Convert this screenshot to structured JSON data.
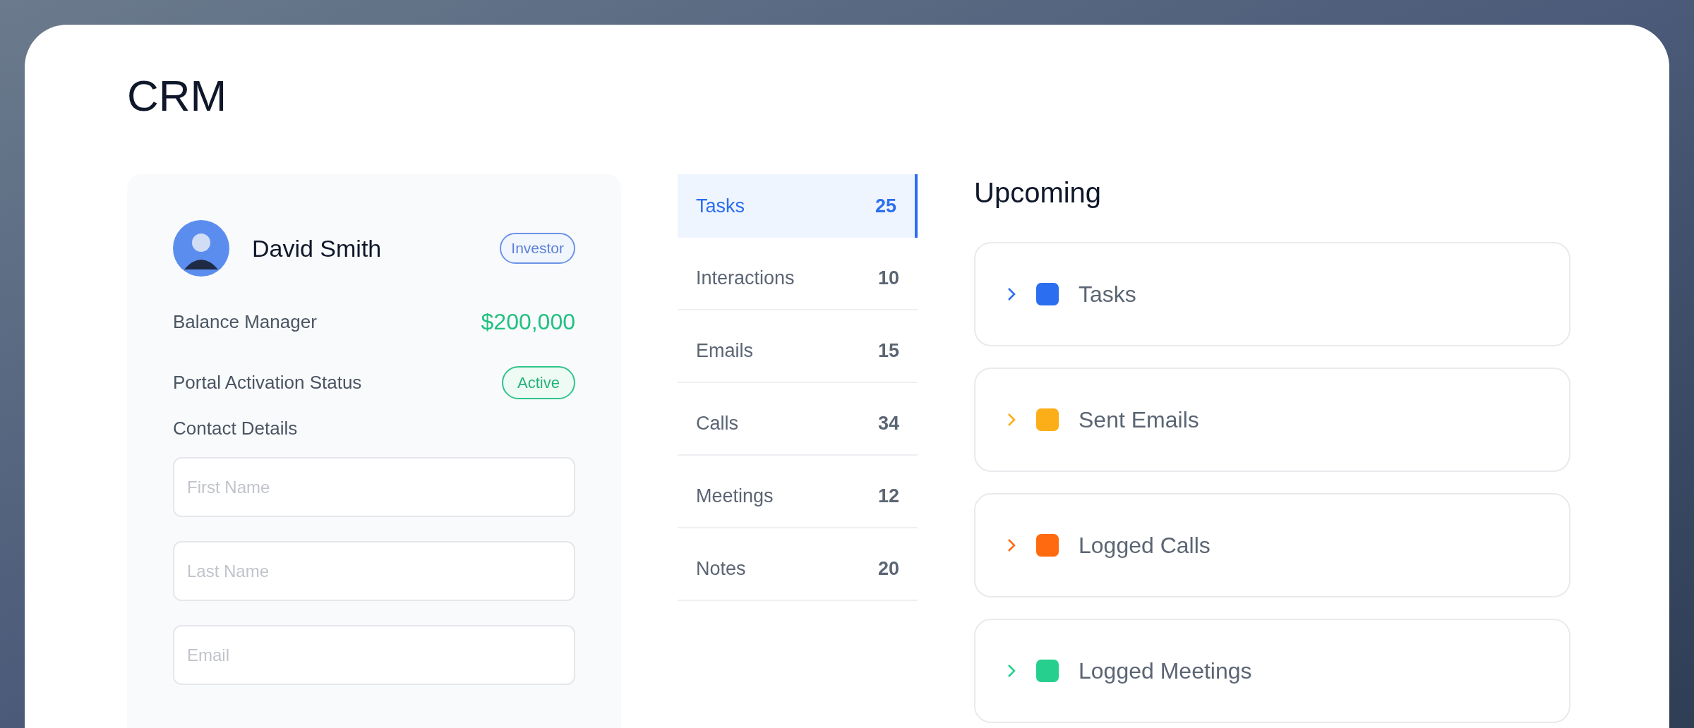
{
  "title": "CRM",
  "contact": {
    "name": "David Smith",
    "badge": "Investor",
    "rows": [
      {
        "kind": "amount",
        "label": "Balance Manager",
        "value": "$200,000"
      },
      {
        "kind": "status",
        "label": "Portal Activation Status",
        "value": "Active"
      }
    ],
    "section": "Contact Details",
    "fields": [
      {
        "placeholder": "First Name"
      },
      {
        "placeholder": "Last Name"
      },
      {
        "placeholder": "Email"
      }
    ]
  },
  "categories": [
    {
      "label": "Tasks",
      "count": "25",
      "selected": true
    },
    {
      "label": "Interactions",
      "count": "10",
      "selected": false
    },
    {
      "label": "Emails",
      "count": "15",
      "selected": false
    },
    {
      "label": "Calls",
      "count": "34",
      "selected": false
    },
    {
      "label": "Meetings",
      "count": "12",
      "selected": false
    },
    {
      "label": "Notes",
      "count": "20",
      "selected": false
    }
  ],
  "upcoming": {
    "title": "Upcoming",
    "items": [
      {
        "label": "Tasks",
        "color": "#2b6ef0",
        "expanded": false
      },
      {
        "label": "Sent Emails",
        "color": "#fbae17",
        "expanded": false
      },
      {
        "label": "Logged Calls",
        "color": "#ff6a10",
        "expanded": false
      },
      {
        "label": "Logged Meetings",
        "color": "#27cf8f",
        "expanded": false
      }
    ]
  }
}
